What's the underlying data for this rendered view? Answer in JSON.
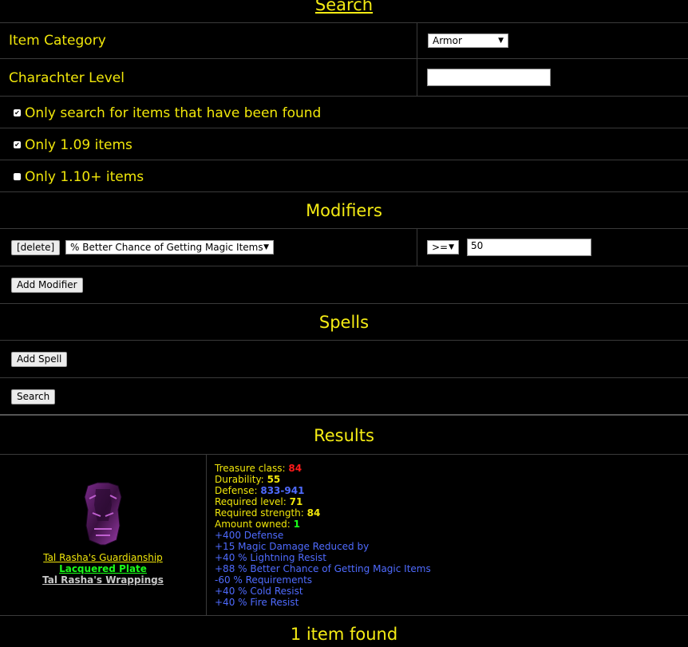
{
  "search": {
    "heading": "Search",
    "item_category_label": "Item Category",
    "item_category_value": "Armor",
    "char_level_label": "Charachter Level",
    "char_level_value": "",
    "checkboxes": [
      {
        "label": "Only search for items that have been found",
        "checked": true
      },
      {
        "label": "Only 1.09 items",
        "checked": true
      },
      {
        "label": "Only 1.10+ items",
        "checked": false
      }
    ]
  },
  "modifiers": {
    "heading": "Modifiers",
    "delete_label": "[delete]",
    "modifier_value": "% Better Chance of Getting Magic Items",
    "operator_value": ">=",
    "amount_value": "50",
    "add_label": "Add Modifier"
  },
  "spells": {
    "heading": "Spells",
    "add_label": "Add Spell",
    "search_label": "Search"
  },
  "results": {
    "heading": "Results",
    "item": {
      "set_name": "Tal Rasha's Guardianship",
      "base_name": "Lacquered Plate",
      "set_group": "Tal Rasha's Wrappings",
      "treasure_class_label": "Treasure class:",
      "treasure_class": "84",
      "durability_label": "Durability:",
      "durability": "55",
      "defense_label": "Defense:",
      "defense": "833-941",
      "req_level_label": "Required level:",
      "req_level": "71",
      "req_strength_label": "Required strength:",
      "req_strength": "84",
      "owned_label": "Amount owned:",
      "owned": "1",
      "mods": [
        "+400 Defense",
        "+15 Magic Damage Reduced by",
        "+40 % Lightning Resist",
        "+88 % Better Chance of Getting Magic Items",
        "-60 % Requirements",
        "+40 % Cold Resist",
        "+40 % Fire Resist"
      ]
    },
    "count_text": "1 item found"
  },
  "colors": {
    "text_yellow": "#f0e60a",
    "stat_red": "#ff1a1a",
    "stat_blue": "#4f6bff",
    "stat_green": "#1aff1a",
    "set_green": "#1aff1a",
    "background": "#000000"
  }
}
